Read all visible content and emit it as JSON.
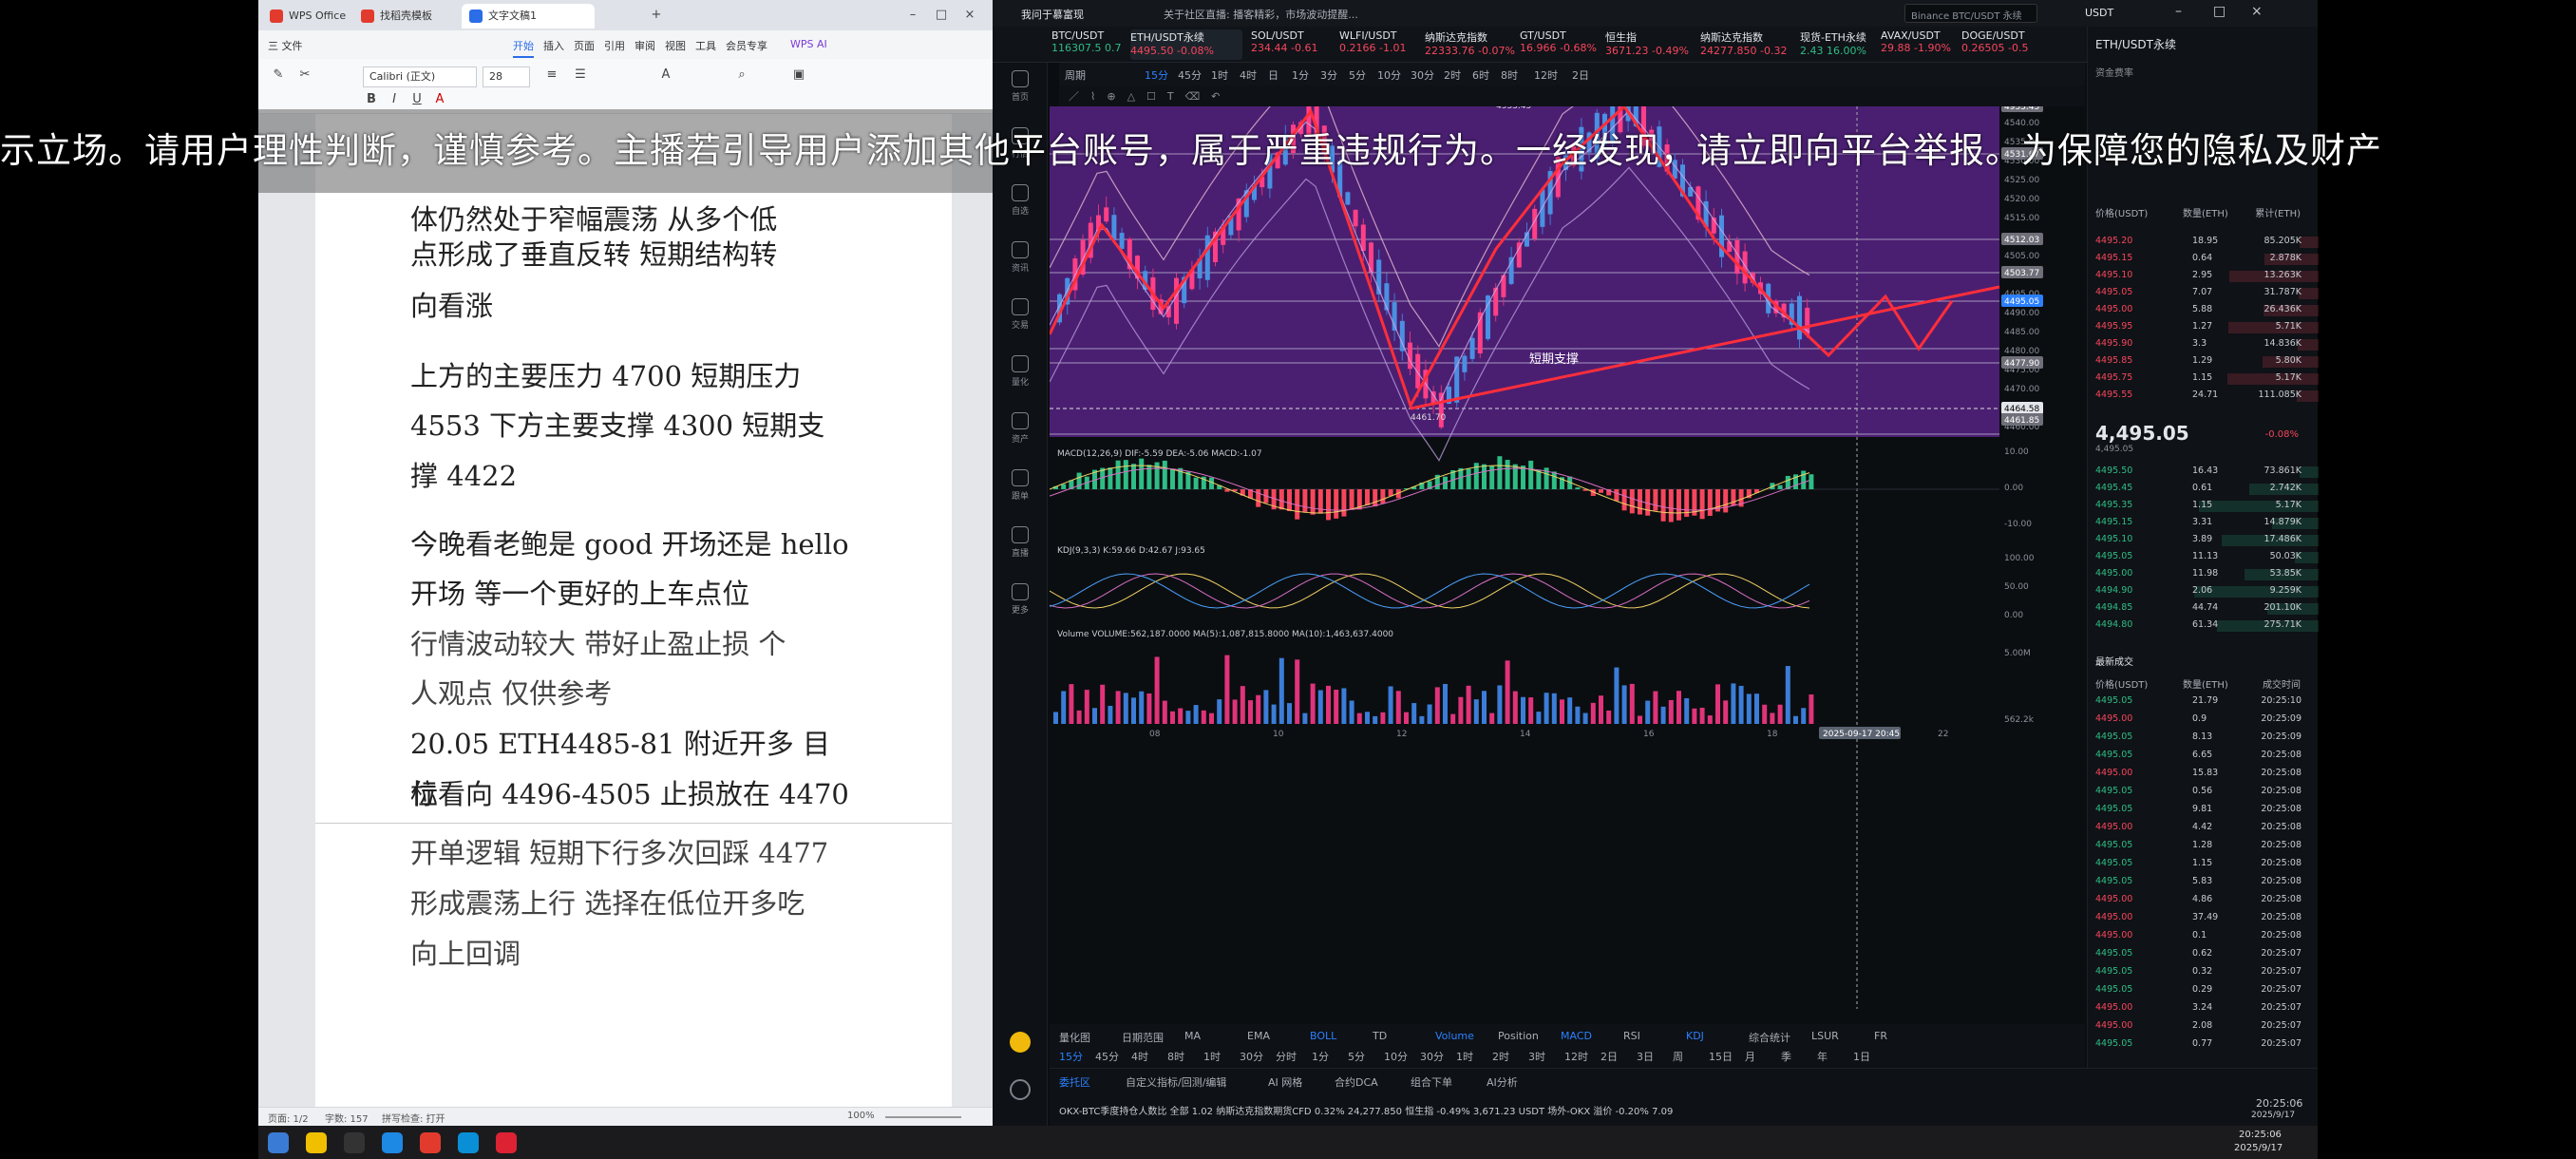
{
  "overlay_banner": "示立场。请用户理性判断，谨慎参考。主播若引导用户添加其他平台账号，属于严重违规行为。一经发现，请立即向平台举报。为保障您的隐私及财产",
  "wps": {
    "tabs": [
      "WPS Office",
      "找稻壳模板",
      "文字文稿1"
    ],
    "menu": [
      "三 文件",
      "开始",
      "插入",
      "页面",
      "引用",
      "审阅",
      "视图",
      "工具",
      "会员专享",
      "WPS AI"
    ],
    "active_menu": "开始",
    "font_name": "Calibri (正文)",
    "font_size": "28",
    "doc_lines": [
      "体仍然处于窄幅震荡 从多个低",
      "点形成了垂直反转 短期结构转",
      "向看涨",
      "上方的主要压力 4700 短期压力",
      "4553 下方主要支撑 4300 短期支",
      "撑 4422",
      "今晚看老鲍是 good 开场还是 hello",
      "开场 等一个更好的上车点位",
      "行情波动较大 带好止盈止损 个",
      "人观点 仅供参考",
      "20.05 ETH4485-81 附近开多 目标",
      "位看向 4496-4505 止损放在 4470",
      "开单逻辑 短期下行多次回踩 4477",
      "形成震荡上行 选择在低位开多吃",
      "向上回调"
    ],
    "status": {
      "page": "页面: 1/2",
      "words": "字数: 157",
      "spell": "拼写检查: 打开",
      "zoom": "100%"
    }
  },
  "exchange": {
    "top_title": "我问于慕富现",
    "notice": "关于社区直播: 播客精彩，市场波动提醒...",
    "search": "Binance BTC/USDT 永续",
    "account": "USDT",
    "tickers": [
      {
        "name": "BTC/USDT",
        "price": "116307.5",
        "chg": "0.7"
      },
      {
        "name": "ETH/USDT永续",
        "price": "4495.50",
        "chg": "-0.08%"
      },
      {
        "name": "SOL/USDT",
        "price": "234.44",
        "chg": "-0.61"
      },
      {
        "name": "WLFI/USDT",
        "price": "0.2166",
        "chg": "-1.01"
      },
      {
        "name": "纳斯达克指数",
        "price": "22333.76",
        "chg": "-0.07%"
      },
      {
        "name": "GT/USDT",
        "price": "16.966",
        "chg": "-0.68%"
      },
      {
        "name": "恒生指",
        "price": "3671.23",
        "chg": "-0.49%"
      },
      {
        "name": "纳斯达克指数",
        "price": "24277.850",
        "chg": "-0.32"
      },
      {
        "name": "现货-ETH永续",
        "price": "2.43",
        "chg": "16.00%"
      },
      {
        "name": "AVAX/USDT",
        "price": "29.88",
        "chg": "-1.90%"
      },
      {
        "name": "DOGE/USDT",
        "price": "0.26505",
        "chg": "-0.5"
      }
    ],
    "chart_toolbar": [
      "周期",
      "15分",
      "45分",
      "1时",
      "4时",
      "日",
      "1分",
      "3分",
      "5分",
      "10分",
      "30分",
      "2时",
      "6时",
      "8时",
      "12时",
      "2日"
    ],
    "active_tf": "15分",
    "side_nav": [
      "首页",
      "行情",
      "自选",
      "资讯",
      "交易",
      "量化",
      "资产",
      "跟单",
      "直播",
      "更多"
    ],
    "price_labels": [
      "4953.45",
      "4461.70"
    ],
    "annotation": "短期支撑",
    "axis_prices": [
      "4540.00",
      "4535.00",
      "4530.00",
      "4525.00",
      "4520.00",
      "4515.00",
      "4510.00",
      "4505.00",
      "4500.00",
      "4495.00",
      "4490.00",
      "4485.00",
      "4480.00",
      "4475.00",
      "4470.00",
      "4465.00",
      "4460.00"
    ],
    "axis_badges": [
      "4953.45",
      "4531.67",
      "4512.03",
      "4503.77",
      "4495.05",
      "4477.90",
      "4464.58",
      "4461.85"
    ],
    "x_labels": [
      "08",
      "10",
      "12",
      "14",
      "16",
      "18",
      "2025-09-17 20:45",
      "22"
    ],
    "indicators": {
      "macd": "MACD(12,26,9) DIF:-5.59 DEA:-5.06 MACD:-1.07",
      "kdj": "KDJ(9,3,3) K:59.66 D:42.67 J:93.65",
      "vol": "Volume VOLUME:562,187.0000 MA(5):1,087,815.8000 MA(10):1,463,637.4000"
    },
    "macd_axis": [
      "10.00",
      "0.00",
      "-10.00"
    ],
    "kdj_axis": [
      "100.00",
      "50.00",
      "0.00"
    ],
    "vol_axis": [
      "5.00M",
      "562.2k"
    ],
    "bottom_tools": [
      "量化图",
      "日期范围",
      "MA",
      "EMA",
      "BOLL",
      "TD",
      "Volume",
      "Position",
      "MACD",
      "RSI",
      "KDJ",
      "综合统计",
      "LSUR",
      "FR"
    ],
    "bottom_tf": [
      "15分",
      "45分",
      "4时",
      "8时",
      "1时",
      "30分",
      "分时",
      "1分",
      "5分",
      "10分",
      "30分",
      "1时",
      "2时",
      "3时",
      "12时",
      "2日",
      "3日",
      "周",
      "15日",
      "月",
      "季",
      "年",
      "1日"
    ],
    "bottom_panel_tabs": [
      "委托区",
      "自定义指标/回测/编辑",
      "AI 网格",
      "合约DCA",
      "组合下单",
      "AI分析"
    ],
    "bottom_ticker": "OKX-BTC季度持仓人数比  全部  1.02     纳斯达克指数期货CFD  0.32%  24,277.850     恒生指  -0.49%  3,671.23     USDT 场外-OKX  溢价 -0.20%  7.09",
    "clock": "20:25:06",
    "date": "2025/9/17"
  },
  "orderbook": {
    "title": "ETH/USDT永续",
    "fund_rate_label": "资金费率",
    "tabs": [
      "订单簿",
      "最新成交"
    ],
    "cols": [
      "价格(USDT)",
      "数量(ETH)",
      "累计(ETH)"
    ],
    "asks": [
      [
        "4495.20",
        "18.95",
        "85.205K"
      ],
      [
        "4495.15",
        "0.64",
        "2.878K"
      ],
      [
        "4495.10",
        "2.95",
        "13.263K"
      ],
      [
        "4495.05",
        "7.07",
        "31.787K"
      ],
      [
        "4495.00",
        "5.88",
        "26.436K"
      ],
      [
        "4495.95",
        "1.27",
        "5.71K"
      ],
      [
        "4495.90",
        "3.3",
        "14.836K"
      ],
      [
        "4495.85",
        "1.29",
        "5.80K"
      ],
      [
        "4495.75",
        "1.15",
        "5.17K"
      ],
      [
        "4495.55",
        "24.71",
        "111.085K"
      ]
    ],
    "last_price": "4,495.05",
    "last_sub": "4,495.05",
    "last_chg": "-0.08%",
    "bids": [
      [
        "4495.50",
        "16.43",
        "73.861K"
      ],
      [
        "4495.45",
        "0.61",
        "2.742K"
      ],
      [
        "4495.35",
        "1.15",
        "5.17K"
      ],
      [
        "4495.15",
        "3.31",
        "14.879K"
      ],
      [
        "4495.10",
        "3.89",
        "17.486K"
      ],
      [
        "4495.05",
        "11.13",
        "50.03K"
      ],
      [
        "4495.00",
        "11.98",
        "53.85K"
      ],
      [
        "4494.90",
        "2.06",
        "9.259K"
      ],
      [
        "4494.85",
        "44.74",
        "201.10K"
      ],
      [
        "4494.80",
        "61.34",
        "275.71K"
      ]
    ],
    "trades_cols": [
      "价格(USDT)",
      "数量(ETH)",
      "成交时间"
    ],
    "trades": [
      [
        "4495.05",
        "21.79",
        "20:25:10",
        "g"
      ],
      [
        "4495.00",
        "0.9",
        "20:25:09",
        "r"
      ],
      [
        "4495.05",
        "8.13",
        "20:25:09",
        "g"
      ],
      [
        "4495.05",
        "6.65",
        "20:25:08",
        "g"
      ],
      [
        "4495.00",
        "15.83",
        "20:25:08",
        "r"
      ],
      [
        "4495.05",
        "0.56",
        "20:25:08",
        "g"
      ],
      [
        "4495.05",
        "9.81",
        "20:25:08",
        "g"
      ],
      [
        "4495.00",
        "4.42",
        "20:25:08",
        "r"
      ],
      [
        "4495.05",
        "1.28",
        "20:25:08",
        "g"
      ],
      [
        "4495.05",
        "1.15",
        "20:25:08",
        "g"
      ],
      [
        "4495.05",
        "5.83",
        "20:25:08",
        "g"
      ],
      [
        "4495.00",
        "4.86",
        "20:25:08",
        "r"
      ],
      [
        "4495.00",
        "37.49",
        "20:25:08",
        "r"
      ],
      [
        "4495.00",
        "0.1",
        "20:25:08",
        "r"
      ],
      [
        "4495.05",
        "0.62",
        "20:25:07",
        "g"
      ],
      [
        "4495.05",
        "0.32",
        "20:25:07",
        "g"
      ],
      [
        "4495.05",
        "0.29",
        "20:25:07",
        "g"
      ],
      [
        "4495.00",
        "3.24",
        "20:25:07",
        "r"
      ],
      [
        "4495.00",
        "2.08",
        "20:25:07",
        "r"
      ],
      [
        "4495.05",
        "0.77",
        "20:25:07",
        "g"
      ]
    ]
  },
  "colors": {
    "up": "#2ebd85",
    "down": "#f6465d",
    "accent": "#2b80ff",
    "chart_bg": "#4a1f72"
  }
}
